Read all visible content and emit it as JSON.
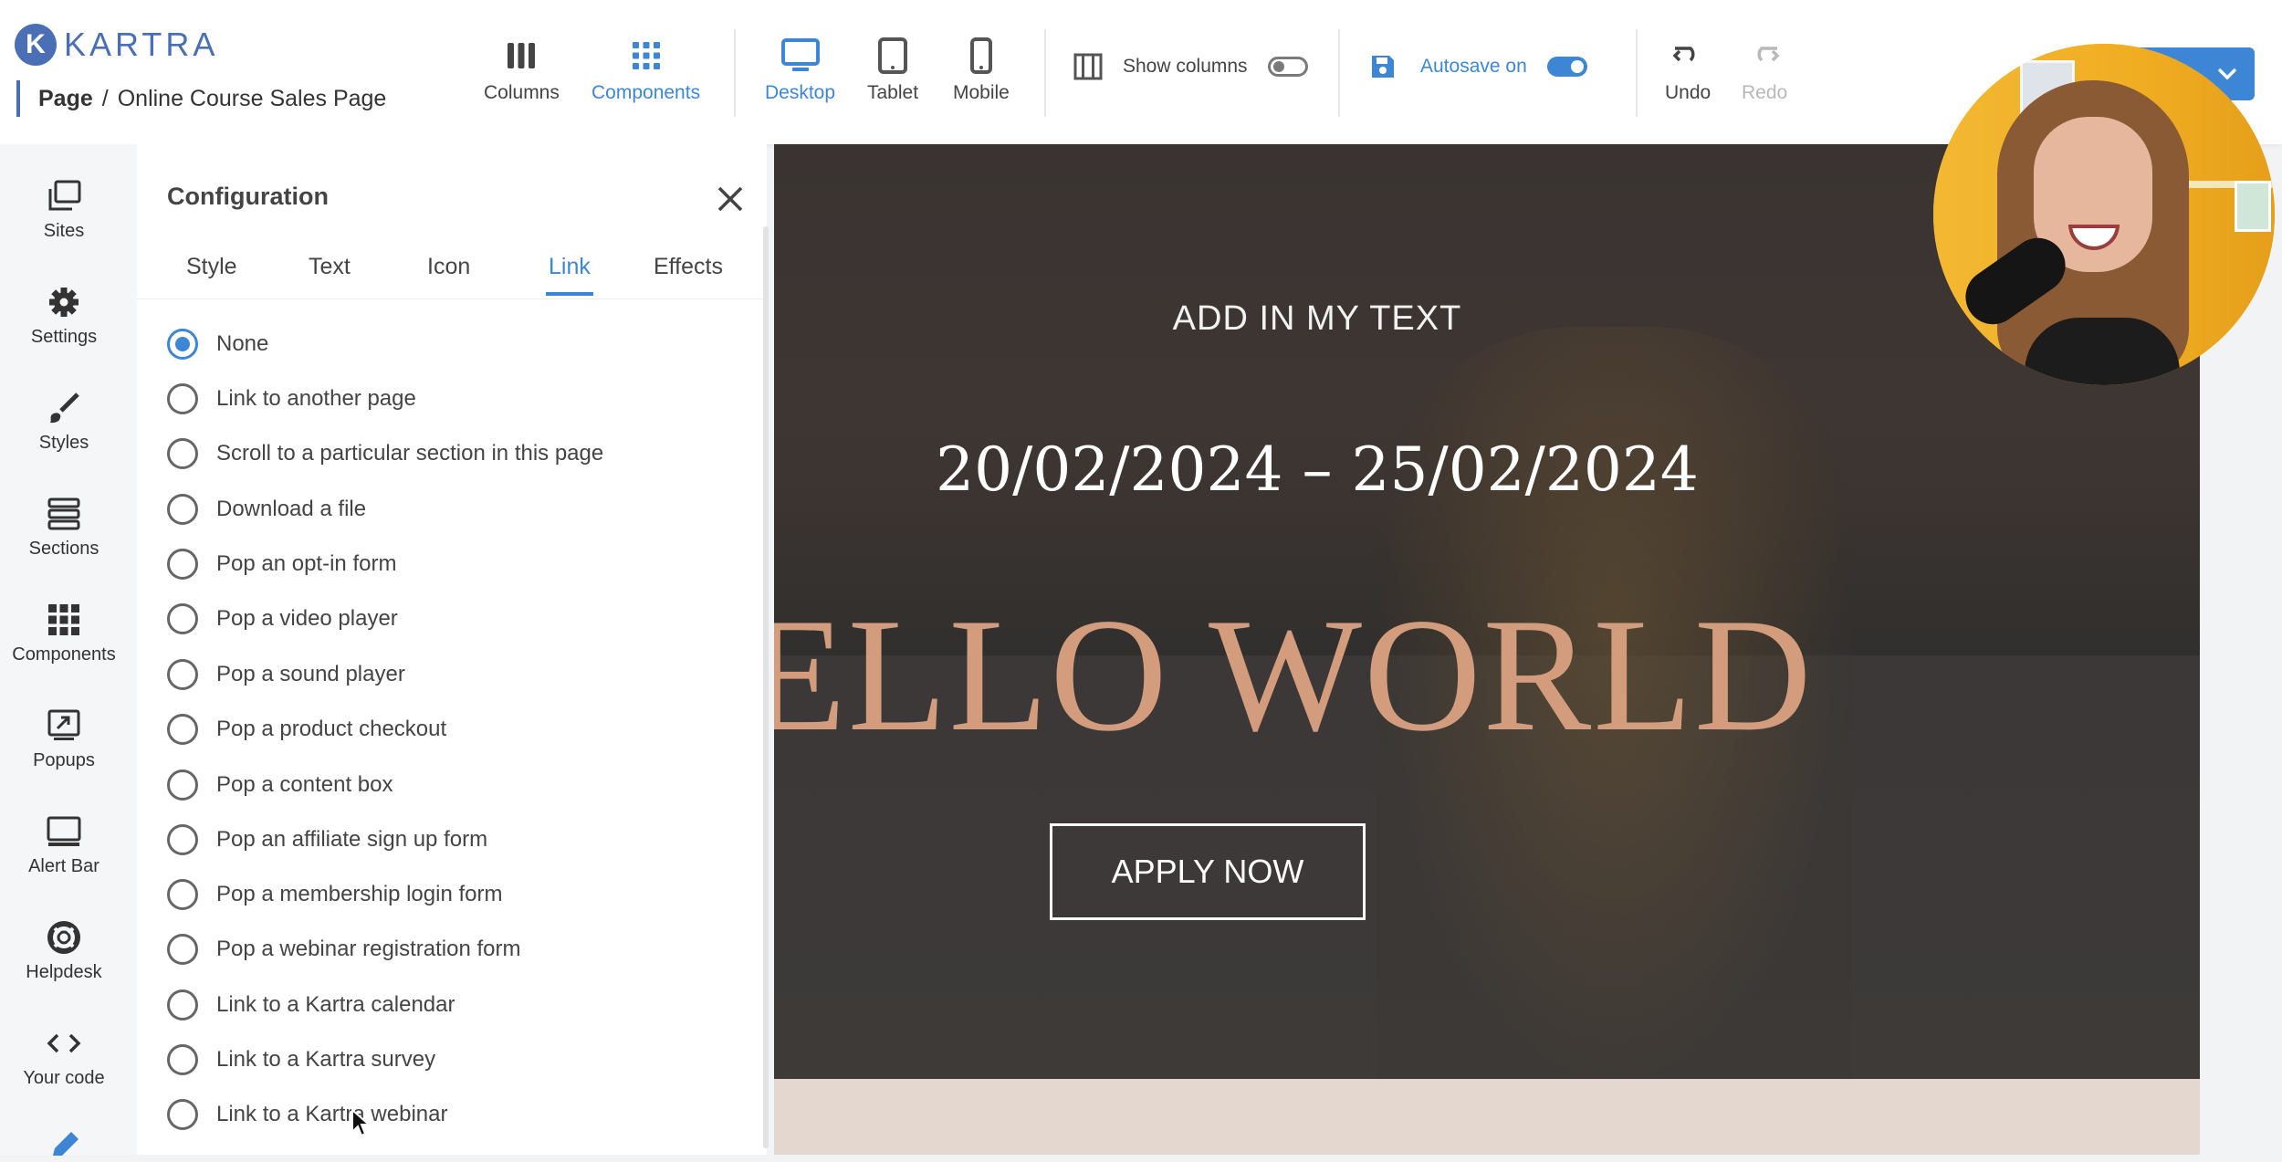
{
  "app": {
    "logo_letter": "K",
    "logo_text": "KARTRA",
    "brand_color": "#4a6fb5",
    "accent_color": "#3d86d6"
  },
  "breadcrumb": {
    "page_label": "Page",
    "separator": "/",
    "page_name": "Online Course Sales Page"
  },
  "toolbar": {
    "columns": "Columns",
    "components": "Components",
    "desktop": "Desktop",
    "tablet": "Tablet",
    "mobile": "Mobile",
    "show_columns": "Show columns",
    "show_columns_enabled": false,
    "autosave": "Autosave on",
    "autosave_enabled": true,
    "undo": "Undo",
    "redo": "Redo"
  },
  "sidebar": {
    "items": [
      {
        "label": "Sites",
        "icon": "sites-icon"
      },
      {
        "label": "Settings",
        "icon": "gear-icon"
      },
      {
        "label": "Styles",
        "icon": "brush-icon"
      },
      {
        "label": "Sections",
        "icon": "sections-icon"
      },
      {
        "label": "Components",
        "icon": "grid-icon"
      },
      {
        "label": "Popups",
        "icon": "popup-icon"
      },
      {
        "label": "Alert Bar",
        "icon": "alert-bar-icon"
      },
      {
        "label": "Helpdesk",
        "icon": "lifebuoy-icon"
      },
      {
        "label": "Your code",
        "icon": "code-icon"
      }
    ]
  },
  "config": {
    "title": "Configuration",
    "tabs": [
      "Style",
      "Text",
      "Icon",
      "Link",
      "Effects"
    ],
    "active_tab": "Link",
    "selected_option": "None",
    "options": [
      "None",
      "Link to another page",
      "Scroll to a particular section in this page",
      "Download a file",
      "Pop an opt-in form",
      "Pop a video player",
      "Pop a sound player",
      "Pop a product checkout",
      "Pop a content box",
      "Pop an affiliate sign up form",
      "Pop a membership login form",
      "Pop a webinar registration form",
      "Link to a Kartra calendar",
      "Link to a Kartra survey",
      "Link to a Kartra webinar"
    ]
  },
  "hero": {
    "subtitle": "ADD IN MY TEXT",
    "date_range": "20/02/2024 – 25/02/2024",
    "title": "ELLO WORLD",
    "cta": "APPLY NOW",
    "title_color": "#d29c7d"
  }
}
